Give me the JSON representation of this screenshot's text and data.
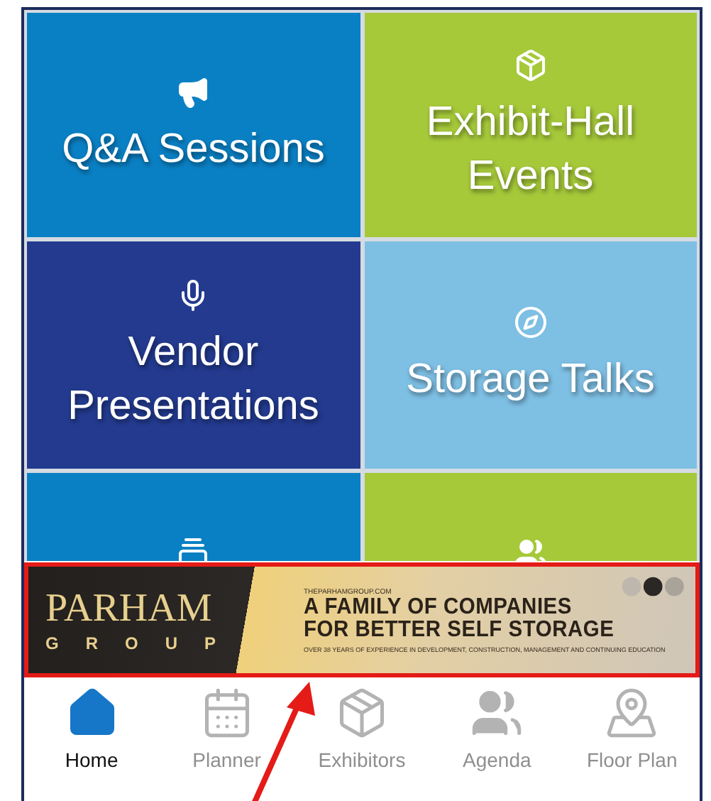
{
  "tiles": [
    {
      "label": "Q&A Sessions",
      "kind": "megaphone",
      "color": "#0a80c4"
    },
    {
      "label": "Exhibit-Hall Events",
      "kind": "package",
      "color": "#a6c93a"
    },
    {
      "label": "Vendor Presentations",
      "kind": "mic",
      "color": "#233a8f"
    },
    {
      "label": "Storage Talks",
      "kind": "compass",
      "color": "#7ebfe4"
    },
    {
      "kind": "gallery",
      "color": "#0a80c4"
    },
    {
      "kind": "users",
      "color": "#a6c93a"
    }
  ],
  "banner": {
    "logo_word": "PARHAM",
    "logo_sub": "GROUP",
    "site": "THEPARHAMGROUP.COM",
    "headline": [
      "A FAMILY OF COMPANIES",
      "FOR BETTER SELF STORAGE"
    ],
    "tagline": "OVER 38 YEARS OF EXPERIENCE IN DEVELOPMENT, CONSTRUCTION, MANAGEMENT AND CONTINUING EDUCATION"
  },
  "tabs": [
    {
      "label": "Home",
      "kind": "home",
      "selected": true
    },
    {
      "label": "Planner",
      "kind": "calendar",
      "selected": false
    },
    {
      "label": "Exhibitors",
      "kind": "package",
      "selected": false
    },
    {
      "label": "Agenda",
      "kind": "users",
      "selected": false
    },
    {
      "label": "Floor Plan",
      "kind": "map",
      "selected": false
    }
  ]
}
